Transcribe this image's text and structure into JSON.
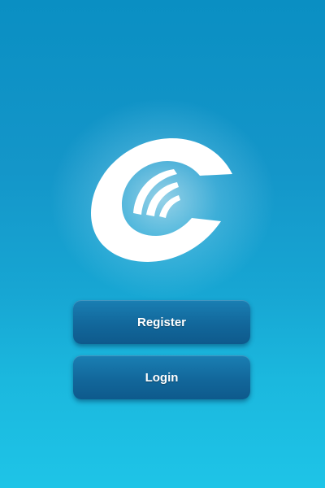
{
  "app": {
    "logo_icon": "c-signal-logo-icon"
  },
  "actions": {
    "register_label": "Register",
    "login_label": "Login"
  },
  "colors": {
    "background_top": "#0a8fc3",
    "background_bottom": "#1ec4e7",
    "button": "#12679b",
    "logo": "#ffffff"
  }
}
